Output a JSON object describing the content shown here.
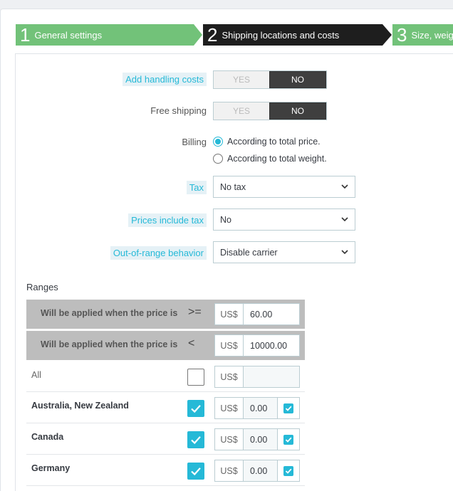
{
  "wizard": {
    "steps": [
      {
        "num": "1",
        "label": "General settings"
      },
      {
        "num": "2",
        "label": "Shipping locations and costs"
      },
      {
        "num": "3",
        "label": "Size, weig"
      }
    ]
  },
  "form": {
    "handling": {
      "label": "Add handling costs",
      "yes": "YES",
      "no": "NO",
      "value": "NO"
    },
    "free_shipping": {
      "label": "Free shipping",
      "yes": "YES",
      "no": "NO",
      "value": "NO"
    },
    "billing": {
      "label": "Billing",
      "options": [
        "According to total price.",
        "According to total weight."
      ],
      "selected": "According to total price."
    },
    "tax": {
      "label": "Tax",
      "value": "No tax"
    },
    "prices_include_tax": {
      "label": "Prices include tax",
      "value": "No"
    },
    "out_of_range": {
      "label": "Out-of-range behavior",
      "value": "Disable carrier"
    }
  },
  "ranges": {
    "title": "Ranges",
    "currency": "US$",
    "rows": [
      {
        "text": "Will be applied when the price is",
        "op": ">=",
        "value": "60.00"
      },
      {
        "text": "Will be applied when the price is",
        "op": "<",
        "value": "10000.00"
      }
    ],
    "zones": [
      {
        "name": "All",
        "checked": false,
        "value": "",
        "bold": false
      },
      {
        "name": "Australia, New Zealand",
        "checked": true,
        "value": "0.00",
        "bold": true
      },
      {
        "name": "Canada",
        "checked": true,
        "value": "0.00",
        "bold": true
      },
      {
        "name": "Germany",
        "checked": true,
        "value": "0.00",
        "bold": true
      }
    ]
  },
  "colors": {
    "accent": "#25b9d7",
    "step_done": "#72c279",
    "step_active": "#1e1e1e"
  }
}
